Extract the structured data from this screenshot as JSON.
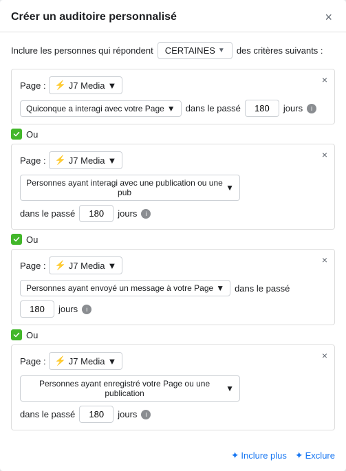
{
  "modal": {
    "title": "Créer un auditoire personnalisé",
    "close_label": "×"
  },
  "intro": {
    "text_before": "Inclure les personnes qui répondent",
    "criteria_btn": "CERTAINES",
    "text_after": "des critères suivants :"
  },
  "blocks": [
    {
      "id": 1,
      "page_label": "Page :",
      "page_name": "J7 Media",
      "condition": "Quiconque a interagi avec votre Page",
      "dans_label": "dans le passé",
      "days_value": "180",
      "jours_label": "jours"
    },
    {
      "id": 2,
      "page_label": "Page :",
      "page_name": "J7 Media",
      "condition": "Personnes ayant interagi avec une publication ou une pub",
      "dans_label": "dans le passé",
      "days_value": "180",
      "jours_label": "jours"
    },
    {
      "id": 3,
      "page_label": "Page :",
      "page_name": "J7 Media",
      "condition": "Personnes ayant envoyé un message à votre Page",
      "dans_label": "dans le passé",
      "days_value": "180",
      "jours_label": "jours"
    },
    {
      "id": 4,
      "page_label": "Page :",
      "page_name": "J7 Media",
      "condition": "Personnes ayant enregistré votre Page ou une publication",
      "dans_label": "dans le passé",
      "days_value": "180",
      "jours_label": "jours"
    }
  ],
  "ou_label": "Ou",
  "footer": {
    "include_label": "Inclure plus",
    "exclude_label": "Exclure"
  }
}
